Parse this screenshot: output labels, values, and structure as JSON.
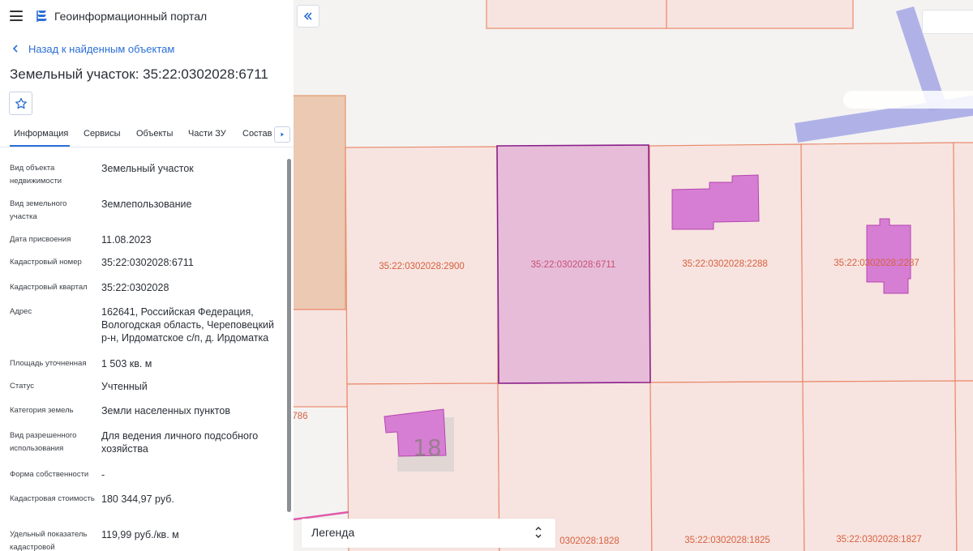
{
  "app": {
    "title": "Геоинформационный портал"
  },
  "nav": {
    "back_label": "Назад к найденным объектам"
  },
  "object": {
    "title": "Земельный участок: 35:22:0302028:6711"
  },
  "tabs": [
    {
      "label": "Информация",
      "active": true
    },
    {
      "label": "Сервисы",
      "active": false
    },
    {
      "label": "Объекты",
      "active": false
    },
    {
      "label": "Части ЗУ",
      "active": false
    },
    {
      "label": "Состав",
      "active": false
    }
  ],
  "properties": [
    {
      "label": "Вид объекта недвижимости",
      "value": "Земельный участок"
    },
    {
      "label": "Вид земельного участка",
      "value": "Землепользование"
    },
    {
      "label": "Дата присвоения",
      "value": "11.08.2023"
    },
    {
      "label": "Кадастровый номер",
      "value": "35:22:0302028:6711"
    },
    {
      "label": "Кадастровый квартал",
      "value": "35:22:0302028"
    },
    {
      "label": "Адрес",
      "value": "162641, Российская Федерация, Вологодская область, Череповецкий р-н, Ирдоматское с/п, д. Ирдоматка"
    },
    {
      "label": "Площадь уточненная",
      "value": "1 503 кв. м"
    },
    {
      "label": "Статус",
      "value": "Учтенный"
    },
    {
      "label": "Категория земель",
      "value": "Земли населенных пунктов"
    },
    {
      "label": "Вид разрешенного использования",
      "value": "Для ведения личного подсобного хозяйства"
    },
    {
      "label": "Форма собственности",
      "value": "-"
    },
    {
      "label": "Кадастровая стоимость",
      "value": "180 344,97 руб."
    },
    {
      "label": "Удельный показатель кадастровой",
      "value": "119,99 руб./кв. м"
    }
  ],
  "map": {
    "parcel_labels": [
      "35:22:0302028:2900",
      "35:22:0302028:6711",
      "35:22:0302028:2288",
      "35:22:0302028:2287",
      "786",
      "0302028:1828",
      "35:22:0302028:1825",
      "35:22:0302028:1827"
    ],
    "house_number": "18",
    "legend_label": "Легенда"
  },
  "colors": {
    "accent": "#2b6fd6",
    "parcel_fill": "#f7e4e0",
    "parcel_stroke": "#ea8a6c",
    "selected_fill": "#e6bcd9",
    "selected_stroke": "#8a1e8a",
    "building_fill": "#d67ed3",
    "road": "#a9abe6"
  },
  "icons": {
    "menu": "hamburger-icon",
    "logo": "portal-logo-icon",
    "back": "chevron-left-icon",
    "favorite": "star-icon",
    "tab_scroll": "caret-right-icon",
    "collapse": "double-chevron-left-icon",
    "legend_toggle": "chevron-up-down-icon"
  }
}
